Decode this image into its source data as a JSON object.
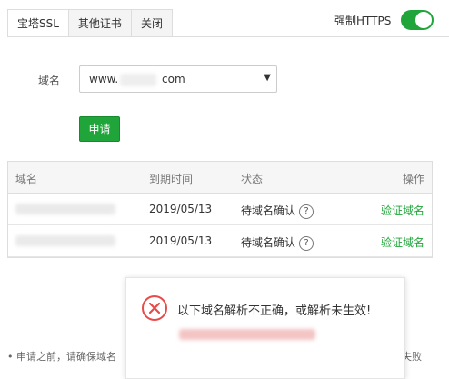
{
  "tabs": [
    {
      "label": "宝塔SSL",
      "active": true
    },
    {
      "label": "其他证书",
      "active": false
    },
    {
      "label": "关闭",
      "active": false
    }
  ],
  "https": {
    "label": "强制HTTPS",
    "enabled": true
  },
  "form": {
    "domain_label": "域名",
    "domain_prefix": "www.",
    "domain_suffix": "com",
    "apply_label": "申请"
  },
  "table": {
    "headers": [
      "域名",
      "到期时间",
      "状态",
      "操作"
    ],
    "rows": [
      {
        "expires": "2019/05/13",
        "status": "待域名确认",
        "action": "验证域名"
      },
      {
        "expires": "2019/05/13",
        "status": "待域名确认",
        "action": "验证域名"
      }
    ]
  },
  "popup": {
    "message": "以下域名解析不正确，或解析未生效!"
  },
  "tips": {
    "left": "申请之前，请确保域名",
    "right": "失败"
  },
  "colors": {
    "accent": "#20a53a",
    "error": "#e84a4a"
  }
}
